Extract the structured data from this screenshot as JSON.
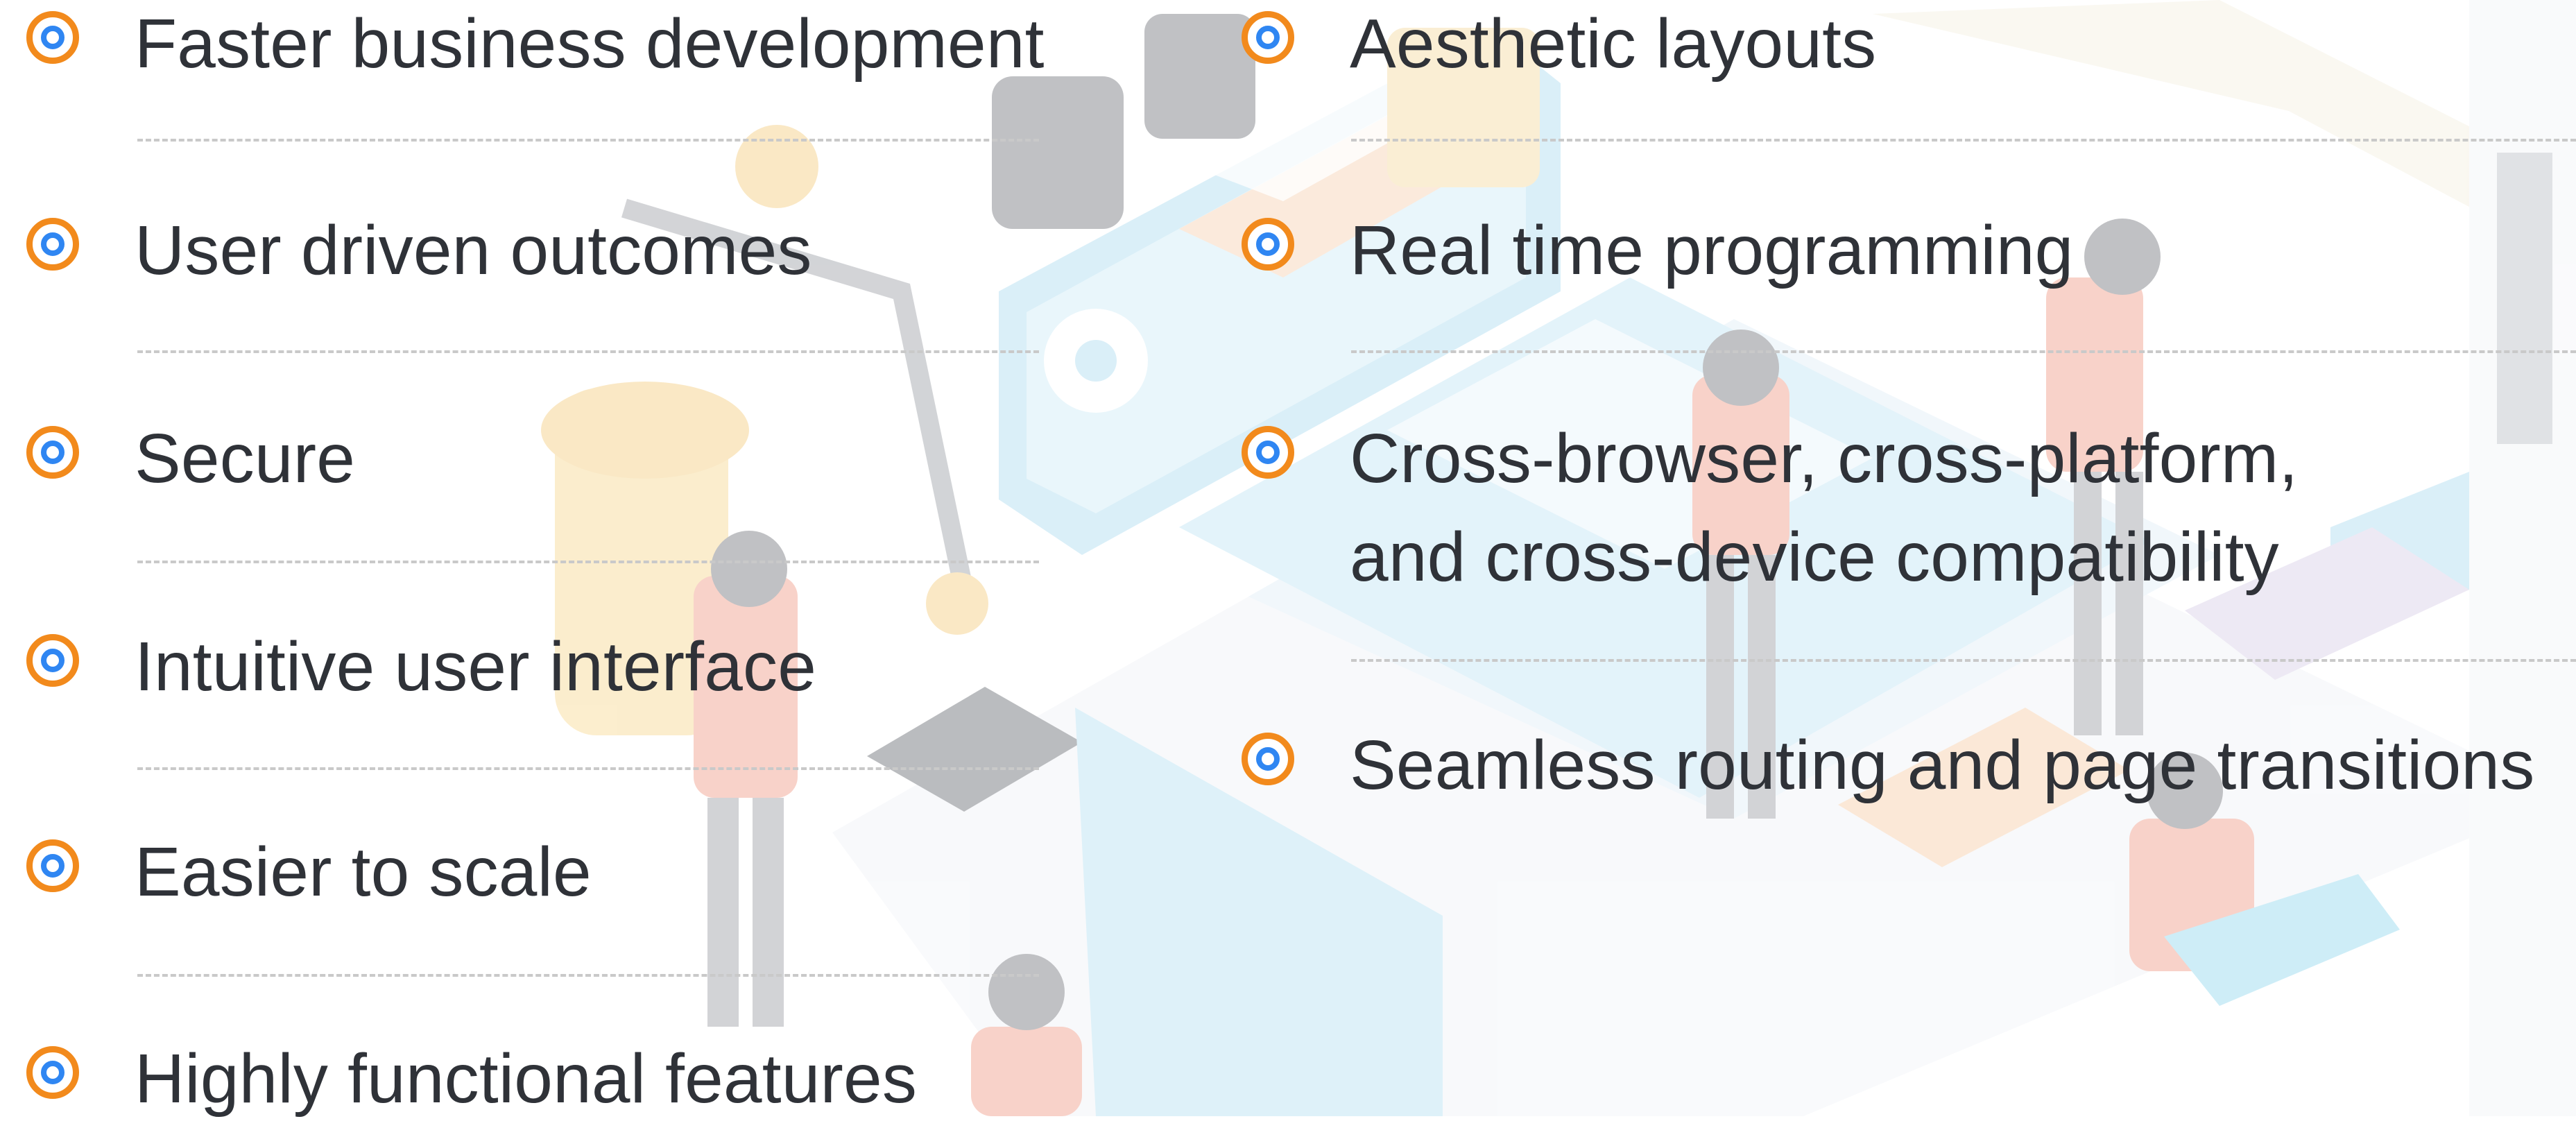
{
  "features": {
    "left": [
      {
        "label": "Faster business development"
      },
      {
        "label": "User driven outcomes"
      },
      {
        "label": "Secure"
      },
      {
        "label": "Intuitive user interface"
      },
      {
        "label": "Easier to scale"
      },
      {
        "label": "Highly functional features"
      }
    ],
    "right": [
      {
        "label": "Aesthetic layouts"
      },
      {
        "label": "Real time programming"
      },
      {
        "label": "Cross-browser, cross-platform,\nand cross-device compatibility"
      },
      {
        "label": "Seamless routing and page transitions"
      }
    ]
  },
  "colors": {
    "bullet_outer": "#f28a1c",
    "bullet_inner": "#2f86f2",
    "text": "#2f3238",
    "divider": "#c9c9c9"
  },
  "icons": {
    "bullet": "target-bullet-icon",
    "background": "isometric-dev-team-illustration"
  }
}
